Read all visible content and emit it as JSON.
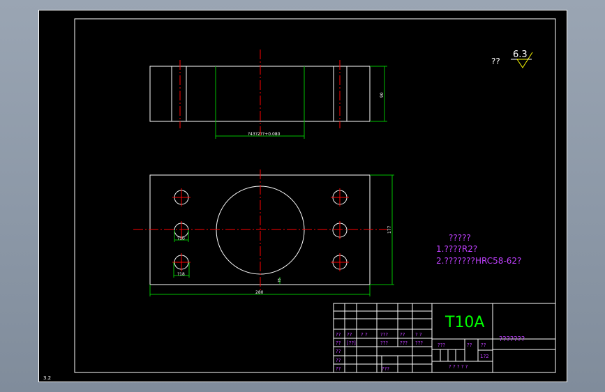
{
  "roughness": {
    "label": "??",
    "value": "6.3"
  },
  "notes": {
    "heading": "?????",
    "line1": "1.????R2?",
    "line2": "2.???????HRC58-62?"
  },
  "dimensions": {
    "top_width": "?43?2??+0.080",
    "top_height": "90",
    "plan_height": "177",
    "plan_width": "280",
    "hole_a": "?10",
    "hole_b": "?18",
    "plate_tag": "?8"
  },
  "title_block": {
    "material": "T10A",
    "drawing_name": "???????",
    "cells": {
      "r1c1": "??",
      "r1c2": "??",
      "r1c3": "? ?",
      "r1c4": "???",
      "r1c5": "??",
      "r1c6": "? ?",
      "r2c1": "??",
      "r2c2": "[??]",
      "r2c3": "???",
      "r2c4": "???",
      "r2c5": "???",
      "r3c1": "??",
      "r4c1": "??",
      "r5c1": "??",
      "r5c2": "???"
    },
    "mid": {
      "stage": "???",
      "weight": "??",
      "scale": "??",
      "scale_value": "1?2",
      "sheet": "? ? ? ? ?"
    }
  },
  "corner_tag": "3.2"
}
